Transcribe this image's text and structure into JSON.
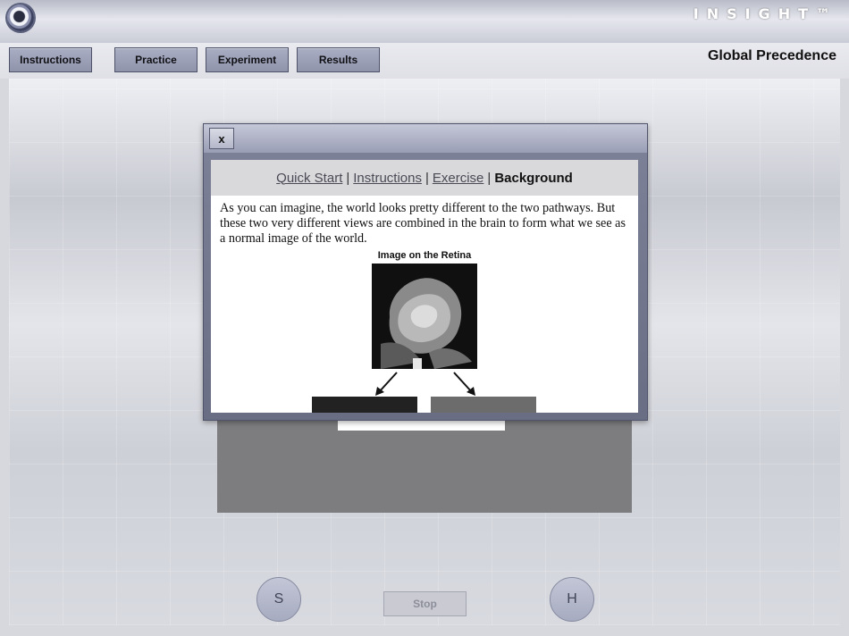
{
  "brand": {
    "logo_text": "INSIGHT™"
  },
  "nav": {
    "buttons": [
      "Instructions",
      "Practice",
      "Experiment",
      "Results"
    ],
    "page_title": "Global Precedence"
  },
  "modal": {
    "close_label": "x",
    "tabs": {
      "quick_start": "Quick Start",
      "instructions": "Instructions",
      "exercise": "Exercise",
      "background": "Background",
      "separator": "|"
    },
    "body": "As you can imagine, the world looks pretty different to the two pathways. But these two very different views are combined in the brain to form what we see as a normal image of the world.",
    "image_title": "Image on the Retina"
  },
  "controls": {
    "left_circle": "S",
    "right_circle": "H",
    "stop": "Stop"
  },
  "colors": {
    "button_fill": "#9ea3b8",
    "modal_frame": "#7e8298"
  }
}
